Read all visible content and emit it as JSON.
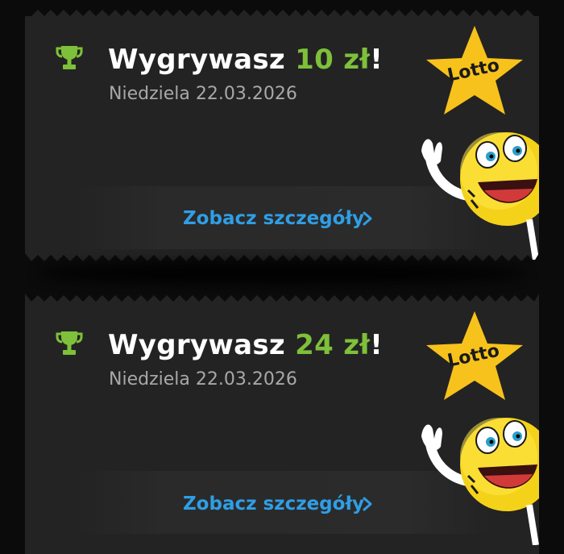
{
  "colors": {
    "background": "#0b0b0b",
    "card": "#232323",
    "accent_green": "#7ec03a",
    "link_blue": "#2f9ee6",
    "date_gray": "#a8a8a8",
    "star_yellow": "#f7c21b"
  },
  "tickets": [
    {
      "title_prefix": "Wygrywasz ",
      "amount": "10 zł",
      "title_suffix": "!",
      "date": "Niedziela 22.03.2026",
      "link_label": "Zobacz szczegóły",
      "badge": "Lotto",
      "icon": "trophy-icon"
    },
    {
      "title_prefix": "Wygrywasz ",
      "amount": "24 zł",
      "title_suffix": "!",
      "date": "Niedziela 22.03.2026",
      "link_label": "Zobacz szczegóły",
      "badge": "Lotto",
      "icon": "trophy-icon"
    }
  ]
}
